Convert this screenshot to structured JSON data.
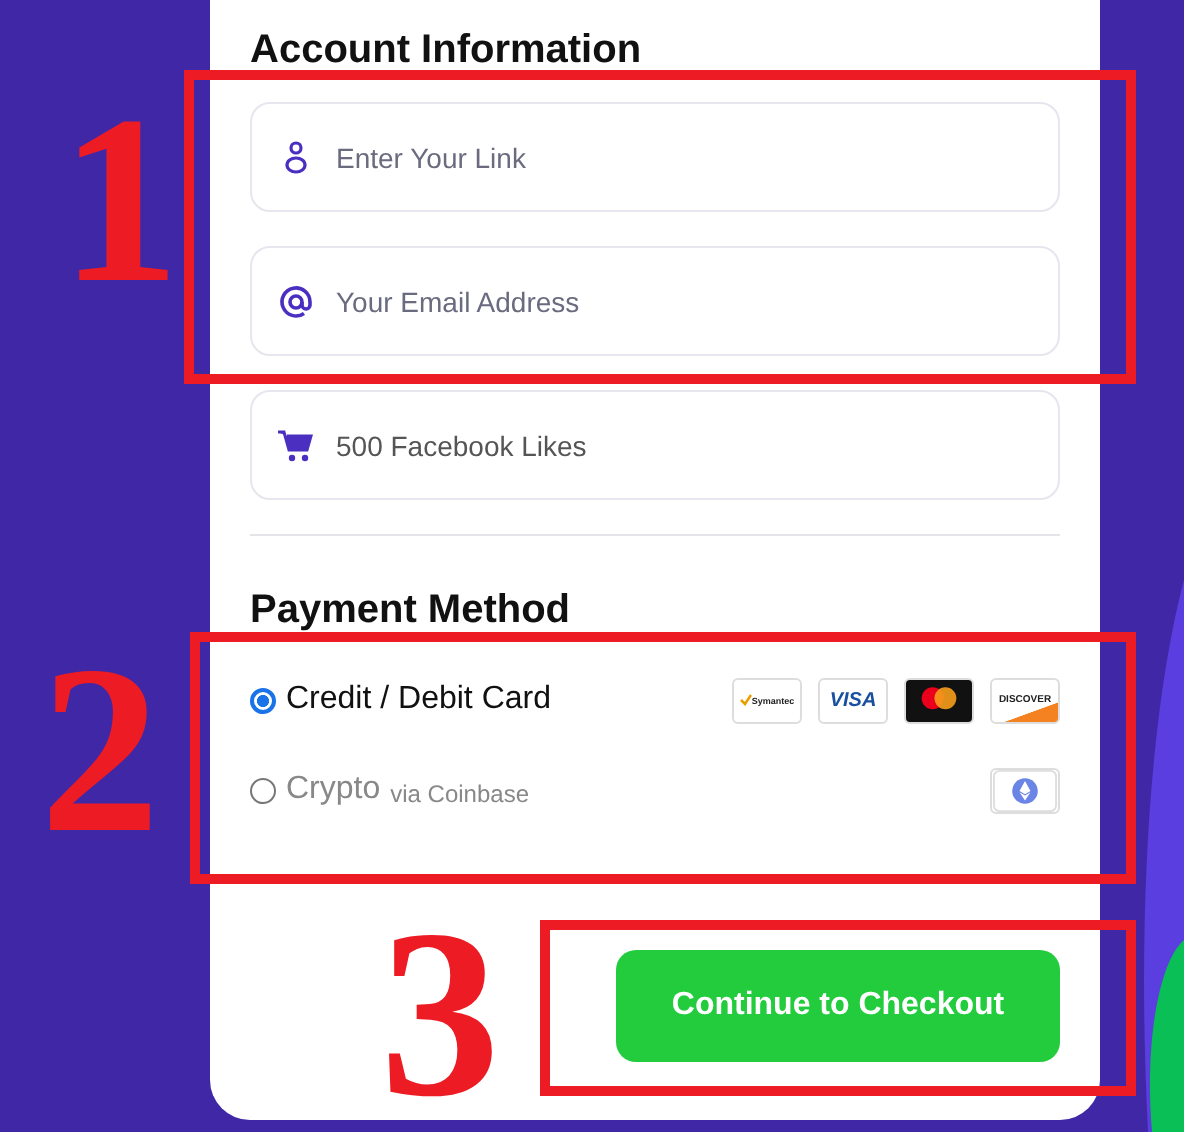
{
  "account_information": {
    "title": "Account Information",
    "fields": [
      {
        "kind": "person",
        "placeholder": "Enter Your Link"
      },
      {
        "kind": "at",
        "placeholder": "Your Email Address"
      },
      {
        "kind": "cart",
        "value": "500 Facebook Likes"
      }
    ]
  },
  "payment_method": {
    "title": "Payment Method",
    "options": [
      {
        "label": "Credit / Debit Card",
        "selected": true,
        "badges": [
          {
            "kind": "check",
            "text": "Symantec"
          },
          {
            "kind": "plain",
            "text": "VISA"
          },
          {
            "kind": "circles"
          },
          {
            "kind": "stripe",
            "text": "DISCOVER"
          }
        ]
      },
      {
        "label": "Crypto",
        "sublabel": "via Coinbase",
        "selected": false,
        "badges": [
          {
            "kind": "diamond"
          }
        ]
      }
    ]
  },
  "checkout_button": {
    "label": "Continue to Checkout"
  },
  "annotations": [
    {
      "number": "1"
    },
    {
      "number": "2"
    },
    {
      "number": "3"
    }
  ]
}
